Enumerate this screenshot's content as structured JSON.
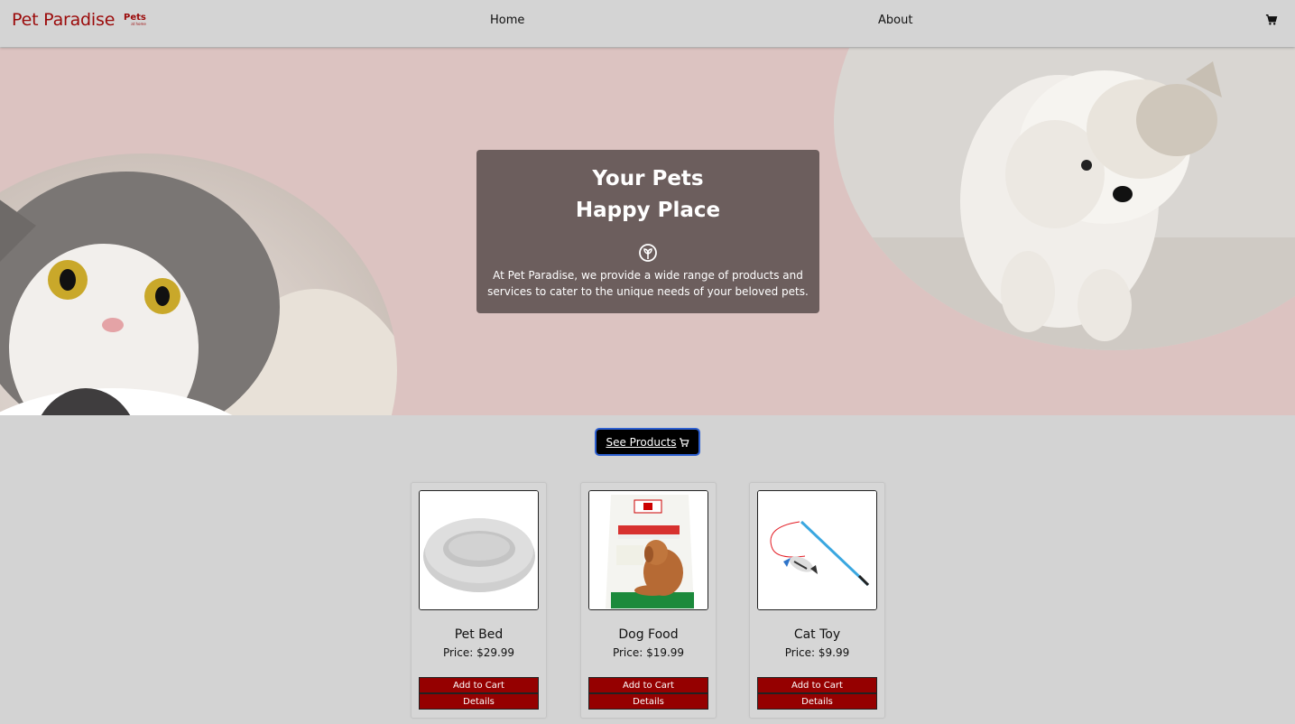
{
  "navbar": {
    "brand": "Pet Paradise",
    "brand_badge": "Pets",
    "brand_badge_small": "at home",
    "links": [
      {
        "label": "Home"
      },
      {
        "label": "About"
      }
    ],
    "cart_icon": "shopping-cart-icon"
  },
  "hero": {
    "title_line1": "Your Pets",
    "title_line2": "Happy Place",
    "icon": "paw-plant-icon",
    "description": "At Pet Paradise, we provide a wide range of products and services to cater to the unique needs of your beloved pets.",
    "background_color": "#dcc3c1",
    "card_color": "#6c5e5d",
    "images": [
      "cat-photo",
      "dog-photo"
    ]
  },
  "cta": {
    "label": "See Products",
    "icon": "cart-icon"
  },
  "products": [
    {
      "name": "Pet Bed",
      "price": "Price: $29.99",
      "add_label": "Add to Cart",
      "details_label": "Details",
      "image": "pet-bed-image"
    },
    {
      "name": "Dog Food",
      "price": "Price: $19.99",
      "add_label": "Add to Cart",
      "details_label": "Details",
      "image": "dog-food-image"
    },
    {
      "name": "Cat Toy",
      "price": "Price: $9.99",
      "add_label": "Add to Cart",
      "details_label": "Details",
      "image": "cat-toy-image"
    }
  ],
  "colors": {
    "accent": "#950000",
    "brand": "#9b0a0a",
    "page_bg": "#d3d3d3"
  }
}
